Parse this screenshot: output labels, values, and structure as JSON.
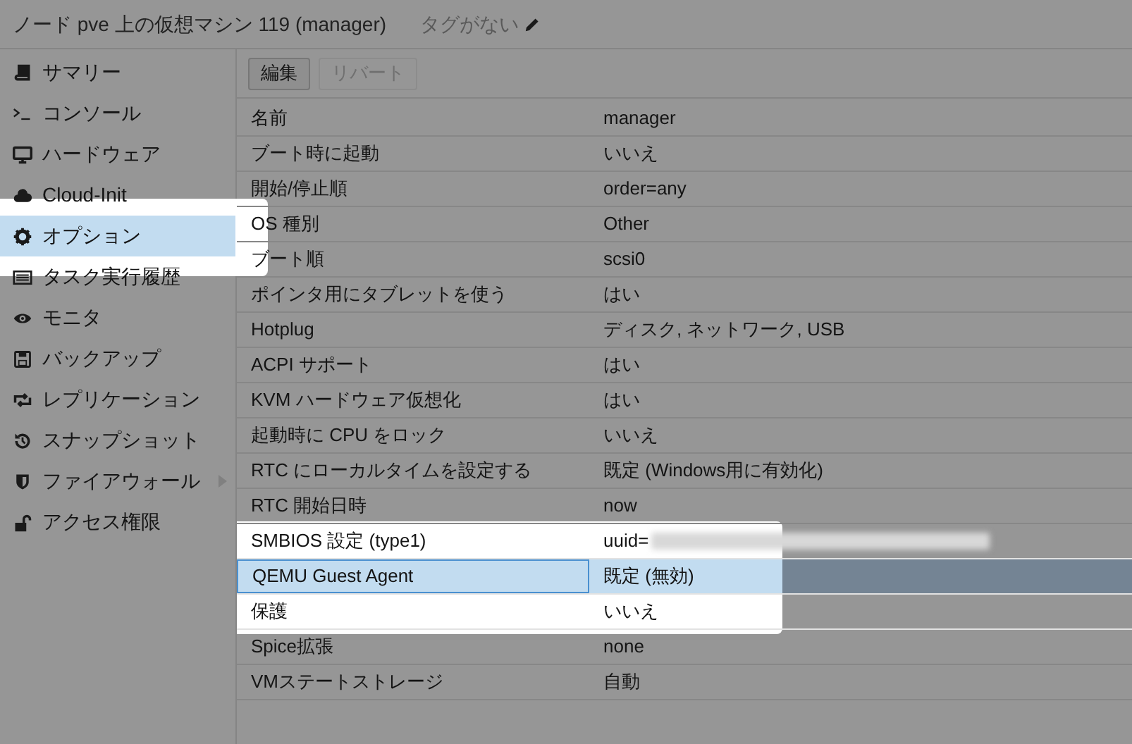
{
  "header": {
    "title": "ノード pve 上の仮想マシン 119 (manager)",
    "tags_label": "タグがない"
  },
  "sidebar": {
    "items": [
      {
        "label": "サマリー",
        "selected": false,
        "spotlight": false,
        "expandable": false
      },
      {
        "label": "コンソール",
        "selected": false,
        "spotlight": false,
        "expandable": false
      },
      {
        "label": "ハードウェア",
        "selected": false,
        "spotlight": false,
        "expandable": false
      },
      {
        "label": "Cloud-Init",
        "selected": false,
        "spotlight": false,
        "expandable": false
      },
      {
        "label": "オプション",
        "selected": true,
        "spotlight": true,
        "expandable": false
      },
      {
        "label": "タスク実行履歴",
        "selected": false,
        "spotlight": false,
        "expandable": false
      },
      {
        "label": "モニタ",
        "selected": false,
        "spotlight": false,
        "expandable": false
      },
      {
        "label": "バックアップ",
        "selected": false,
        "spotlight": false,
        "expandable": false
      },
      {
        "label": "レプリケーション",
        "selected": false,
        "spotlight": false,
        "expandable": false
      },
      {
        "label": "スナップショット",
        "selected": false,
        "spotlight": false,
        "expandable": false
      },
      {
        "label": "ファイアウォール",
        "selected": false,
        "spotlight": false,
        "expandable": true
      },
      {
        "label": "アクセス権限",
        "selected": false,
        "spotlight": false,
        "expandable": false
      }
    ]
  },
  "toolbar": {
    "buttons": [
      {
        "label": "編集",
        "disabled": false
      },
      {
        "label": "リバート",
        "disabled": true
      }
    ]
  },
  "table": {
    "rows": [
      {
        "name": "名前",
        "value": "manager",
        "selected": false,
        "spotlight": false,
        "redacted": false
      },
      {
        "name": "ブート時に起動",
        "value": "いいえ",
        "selected": false,
        "spotlight": false,
        "redacted": false
      },
      {
        "name": "開始/停止順",
        "value": "order=any",
        "selected": false,
        "spotlight": false,
        "redacted": false
      },
      {
        "name": "OS 種別",
        "value": "Other",
        "selected": false,
        "spotlight": false,
        "redacted": false
      },
      {
        "name": "ブート順",
        "value": "scsi0",
        "selected": false,
        "spotlight": false,
        "redacted": false
      },
      {
        "name": "ポインタ用にタブレットを使う",
        "value": "はい",
        "selected": false,
        "spotlight": false,
        "redacted": false
      },
      {
        "name": "Hotplug",
        "value": "ディスク, ネットワーク, USB",
        "selected": false,
        "spotlight": false,
        "redacted": false
      },
      {
        "name": "ACPI サポート",
        "value": "はい",
        "selected": false,
        "spotlight": false,
        "redacted": false
      },
      {
        "name": "KVM ハードウェア仮想化",
        "value": "はい",
        "selected": false,
        "spotlight": false,
        "redacted": false
      },
      {
        "name": "起動時に CPU をロック",
        "value": "いいえ",
        "selected": false,
        "spotlight": false,
        "redacted": false
      },
      {
        "name": "RTC にローカルタイムを設定する",
        "value": "既定 (Windows用に有効化)",
        "selected": false,
        "spotlight": false,
        "redacted": false
      },
      {
        "name": "RTC 開始日時",
        "value": "now",
        "selected": false,
        "spotlight": false,
        "redacted": false
      },
      {
        "name": "SMBIOS 設定 (type1)",
        "value": "uuid=",
        "selected": false,
        "spotlight": true,
        "redacted": true
      },
      {
        "name": "QEMU Guest Agent",
        "value": "既定 (無効)",
        "selected": true,
        "spotlight": true,
        "redacted": false
      },
      {
        "name": "保護",
        "value": "いいえ",
        "selected": false,
        "spotlight": true,
        "redacted": false
      },
      {
        "name": "Spice拡張",
        "value": "none",
        "selected": false,
        "spotlight": false,
        "redacted": false
      },
      {
        "name": "VMステートストレージ",
        "value": "自動",
        "selected": false,
        "spotlight": false,
        "redacted": false
      }
    ]
  }
}
